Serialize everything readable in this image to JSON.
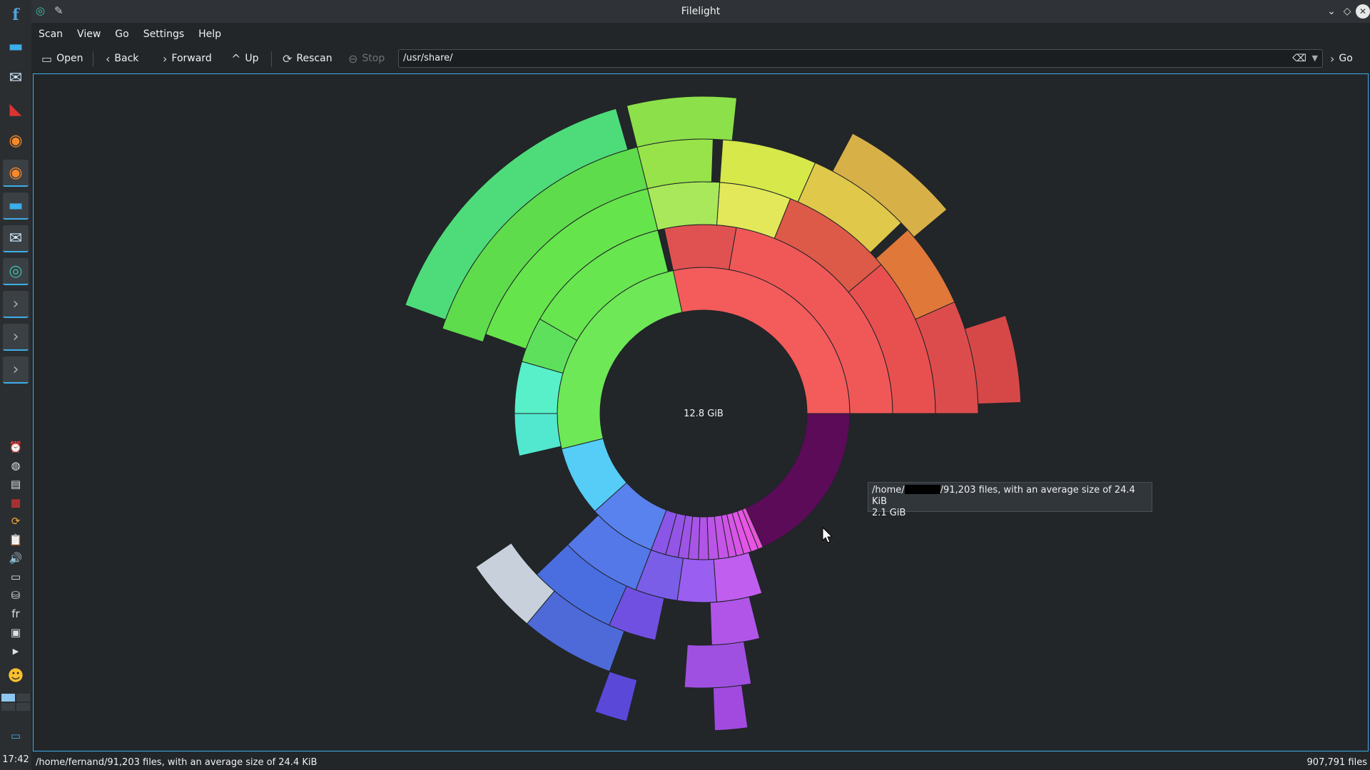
{
  "window": {
    "title": "Filelight"
  },
  "menu": [
    "Scan",
    "View",
    "Go",
    "Settings",
    "Help"
  ],
  "toolbar": {
    "open": "Open",
    "back": "Back",
    "forward": "Forward",
    "up": "Up",
    "rescan": "Rescan",
    "stop": "Stop",
    "go": "Go"
  },
  "location": {
    "value": "/usr/share/"
  },
  "radial": {
    "center_label": "12.8 GiB",
    "segment_color": "#5b0b58"
  },
  "tooltip": {
    "path_prefix": "/home/",
    "path_suffix": "/91,203 files, with an average size of 24.4 KiB",
    "size": "2.1 GiB"
  },
  "status": {
    "left": "/home/fernand/91,203 files, with an average size of 24.4 KiB",
    "right": "907,791 files"
  },
  "panel": {
    "clock": "17:42",
    "layout_indicator": "fr"
  }
}
